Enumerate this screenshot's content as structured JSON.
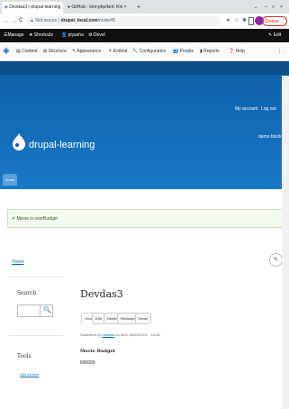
{
  "browser": {
    "tabs": [
      {
        "label": "Devdas3 | drupal-learning"
      },
      {
        "label": "GitHub - kint-php/kint: Kin"
      }
    ],
    "new_tab": "+",
    "window_controls": {
      "minimize": "–",
      "maximize": "□",
      "close": "×",
      "dropdown": "⌄"
    },
    "nav": {
      "back": "←",
      "forward": "→",
      "reload": "C"
    },
    "security": "Not secure",
    "url_domain": "drupal_local.com",
    "url_path": "/node/45",
    "update_label": "Update"
  },
  "toolbar": {
    "manage": "Manage",
    "shortcuts": "Shortcuts",
    "user": "piyasha",
    "devel": "Devel",
    "edit": "Edit"
  },
  "tray": [
    "Content",
    "Structure",
    "Appearance",
    "Extend",
    "Configuration",
    "People",
    "Reports",
    "Help"
  ],
  "header": {
    "my_account": "My account",
    "log_out": "Log out",
    "site_name": "drupal-learning",
    "demo_block": "demo block",
    "home_tab": "Home"
  },
  "message": "Movie is overBudget",
  "breadcrumb": "Home",
  "sidebar": {
    "search_title": "Search",
    "tools_title": "Tools",
    "add_content": "Add content"
  },
  "node": {
    "title": "Devdas3",
    "tabs": [
      "View",
      "Edit",
      "Delete",
      "Revisions",
      "Devel"
    ],
    "submitted_prefix": "Submitted by",
    "submitted_user": "piyasha",
    "submitted_suffix": "on Mon, 08/23/2021 - 10:45",
    "field_label": "Movie Budget",
    "field_value": "600000"
  }
}
